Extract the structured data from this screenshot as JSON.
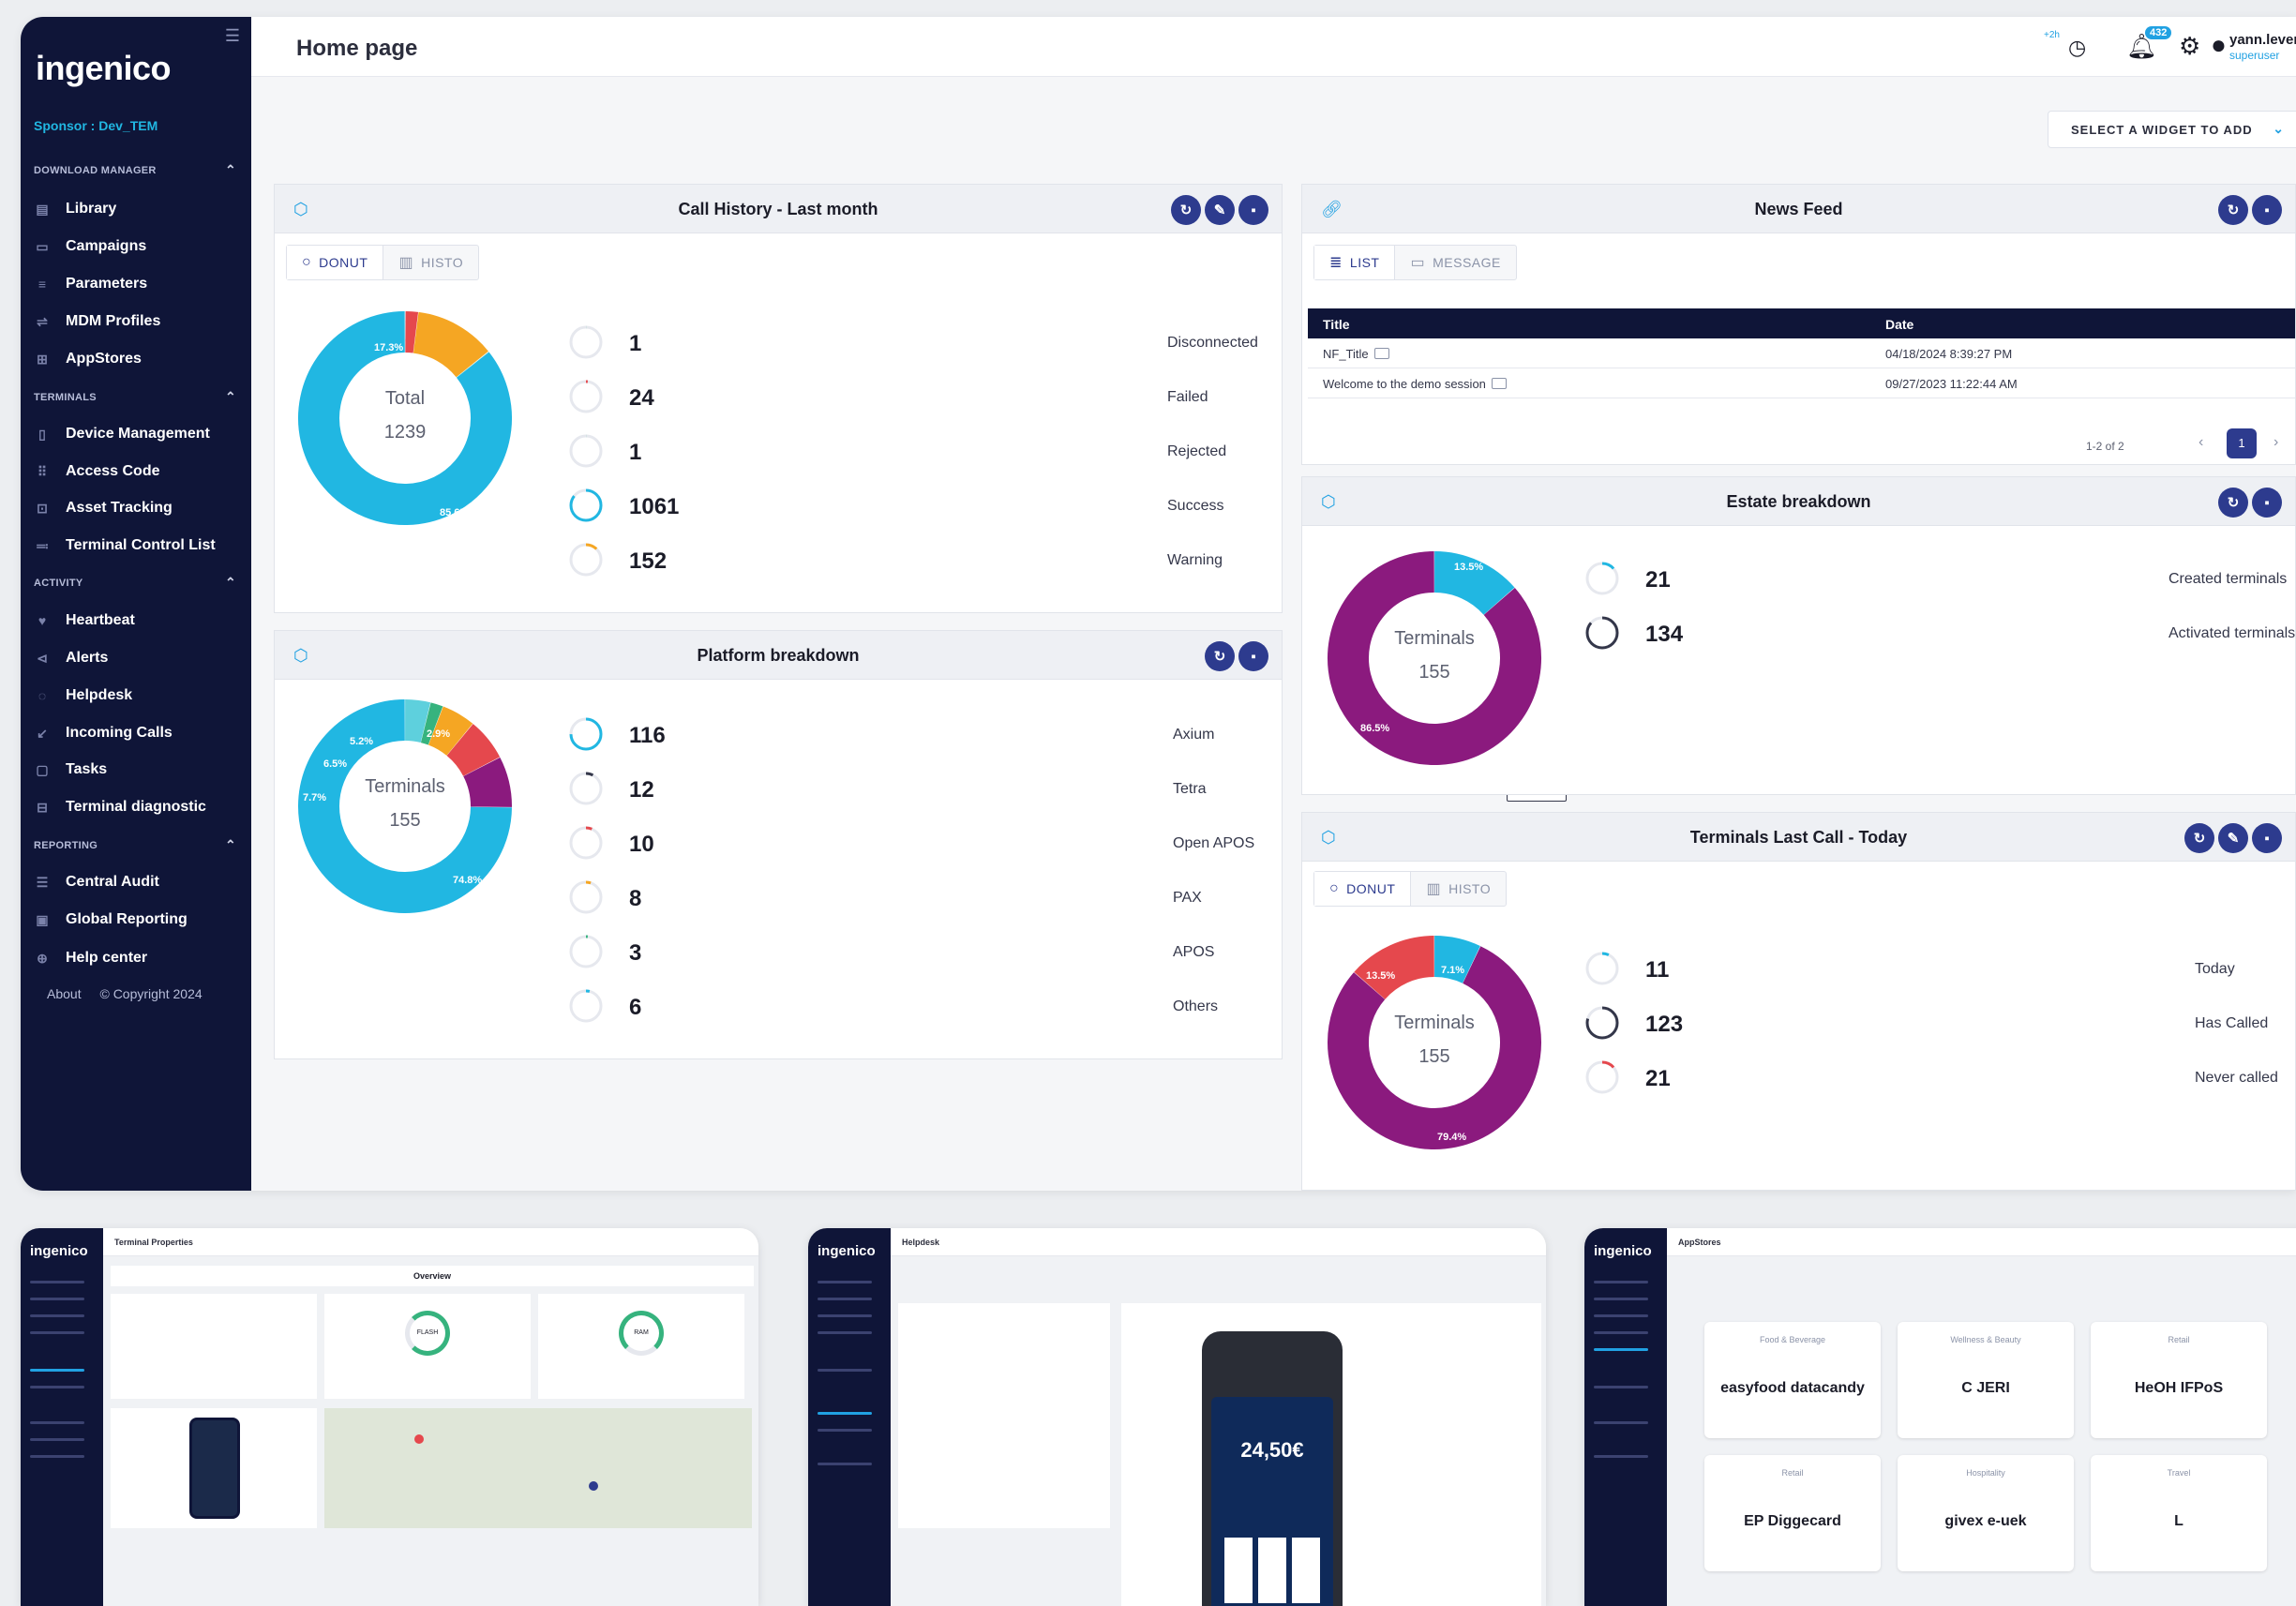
{
  "app": {
    "logo": "ingenico",
    "sponsor": "Sponsor : Dev_TEM",
    "page_title": "Home page"
  },
  "sidebar": {
    "sections": [
      {
        "title": "DOWNLOAD MANAGER",
        "items": [
          "Library",
          "Campaigns",
          "Parameters",
          "MDM Profiles",
          "AppStores"
        ]
      },
      {
        "title": "TERMINALS",
        "items": [
          "Device Management",
          "Access Code",
          "Asset Tracking",
          "Terminal Control List"
        ]
      },
      {
        "title": "ACTIVITY",
        "items": [
          "Heartbeat",
          "Alerts",
          "Helpdesk",
          "Incoming Calls",
          "Tasks",
          "Terminal diagnostic"
        ]
      },
      {
        "title": "REPORTING",
        "items": [
          "Central Audit",
          "Global Reporting",
          "Help center"
        ]
      }
    ],
    "footer_about": "About",
    "footer_copyright": "© Copyright 2024"
  },
  "topbar": {
    "mini_badge": "+2h",
    "notifications_count": "432",
    "username": "yann.levene",
    "role": "superuser"
  },
  "widget_select": {
    "label": "SELECT A WIDGET TO ADD"
  },
  "colors": {
    "navy": "#0f1538",
    "accent": "#21a1e2",
    "action": "#2d3b8e",
    "green": "#36b37e",
    "red": "#e5484d",
    "amber": "#f5a623",
    "purple": "#8b1a7e"
  },
  "call_history": {
    "title": "Call History - Last month",
    "toggle": [
      "DONUT",
      "HISTO"
    ],
    "center_label": "Total",
    "center_value": "1239",
    "rows": [
      {
        "value": "1",
        "label": "Disconnected",
        "pct": "0.1%",
        "color": "#36b37e"
      },
      {
        "value": "24",
        "label": "Failed",
        "pct": "1.9%",
        "color": "#e5484d"
      },
      {
        "value": "1",
        "label": "Rejected",
        "pct": "0.1%",
        "color": "#36b37e"
      },
      {
        "value": "1061",
        "label": "Success",
        "pct": "85.6%",
        "color": "#21b7e2"
      },
      {
        "value": "152",
        "label": "Warning",
        "pct": "12.3%",
        "color": "#f5a623"
      }
    ],
    "slice_labels": [
      "17.3%",
      "85.6%"
    ]
  },
  "platform": {
    "title": "Platform breakdown",
    "center_label": "Terminals",
    "center_value": "155",
    "rows": [
      {
        "value": "116",
        "label": "Axium",
        "pct": "74.8%",
        "color": "#21b7e2"
      },
      {
        "value": "12",
        "label": "Tetra",
        "pct": "7.7%",
        "color": "#34374a"
      },
      {
        "value": "10",
        "label": "Open APOS",
        "pct": "6.5%",
        "color": "#e5484d"
      },
      {
        "value": "8",
        "label": "PAX",
        "pct": "5.2%",
        "color": "#f5a623"
      },
      {
        "value": "3",
        "label": "APOS",
        "pct": "1.9%",
        "color": "#36b37e"
      },
      {
        "value": "6",
        "label": "Others",
        "pct": "3.9%",
        "color": "#21b7e2"
      }
    ],
    "slice_labels": [
      "2.9%",
      "5.2%",
      "6.5%",
      "7.7%",
      "74.8%"
    ]
  },
  "news": {
    "title": "News Feed",
    "toggle": [
      "LIST",
      "MESSAGE"
    ],
    "col_title": "Title",
    "col_date": "Date",
    "rows": [
      {
        "title": "NF_Title",
        "date": "04/18/2024 8:39:27 PM"
      },
      {
        "title": "Welcome to the demo session",
        "date": "09/27/2023 11:22:44 AM"
      }
    ],
    "page_range": "1-2 of 2",
    "current_page": "1"
  },
  "estate": {
    "title": "Estate breakdown",
    "center_label": "Terminals",
    "center_value": "155",
    "rows": [
      {
        "value": "21",
        "label": "Created terminals",
        "pct": "13.5%",
        "color": "#21b7e2"
      },
      {
        "value": "134",
        "label": "Activated terminals",
        "pct": "86.5%",
        "color": "#34374a"
      }
    ],
    "slice_labels": [
      "13.5%",
      "86.5%"
    ]
  },
  "last_call": {
    "title": "Terminals Last Call - Today",
    "toggle": [
      "DONUT",
      "HISTO"
    ],
    "center_label": "Terminals",
    "center_value": "155",
    "rows": [
      {
        "value": "11",
        "label": "Today",
        "pct": "7.1%",
        "color": "#21b7e2"
      },
      {
        "value": "123",
        "label": "Has Called",
        "pct": "79.4%",
        "color": "#34374a"
      },
      {
        "value": "21",
        "label": "Never called",
        "pct": "13.5%",
        "color": "#e5484d"
      }
    ],
    "slice_labels": [
      "13.5%",
      "7.1%",
      "79.4%"
    ]
  },
  "previews": {
    "logo": "ingenico",
    "terminal_title": "Terminal Properties",
    "terminal_overview": "Overview",
    "flash_label": "FLASH",
    "ram_label": "RAM",
    "helpdesk_title": "Helpdesk",
    "amount": "24,50€",
    "appstores_title": "AppStores",
    "tiles": [
      {
        "cat": "Food & Beverage",
        "brands": "easyfood  datacandy"
      },
      {
        "cat": "Wellness & Beauty",
        "brands": "C  JERI"
      },
      {
        "cat": "Retail",
        "brands": "HeOH  IFPoS"
      },
      {
        "cat": "Retail",
        "brands": "EP  Diggecard"
      },
      {
        "cat": "Hospitality",
        "brands": "givex  e-uek"
      },
      {
        "cat": "Travel",
        "brands": "L"
      }
    ]
  }
}
